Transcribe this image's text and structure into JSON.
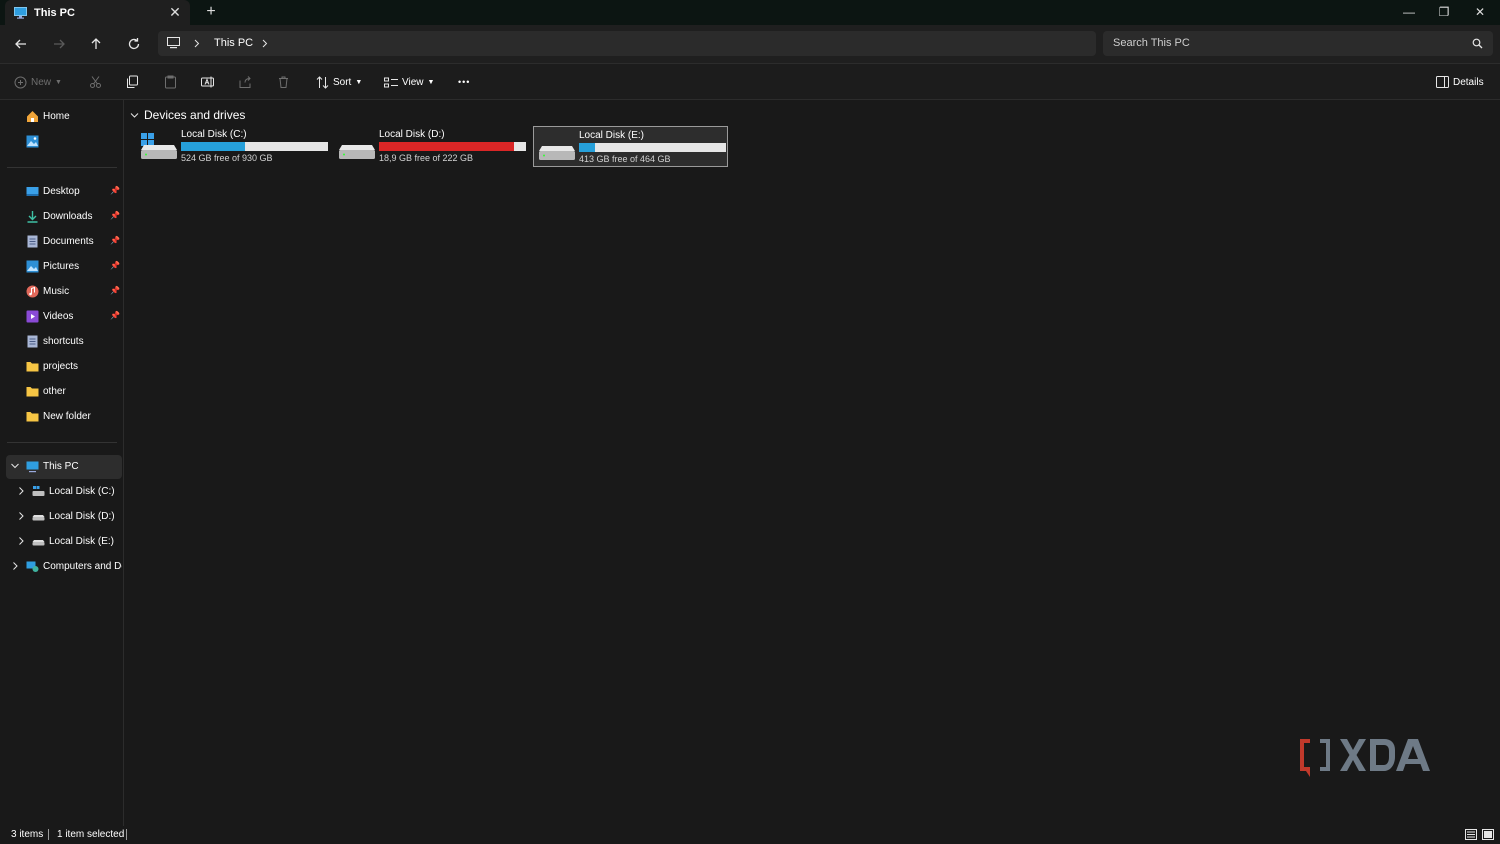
{
  "window": {
    "tab_title": "This PC",
    "tab_close": "✕",
    "new_tab": "+",
    "minimize": "—",
    "maximize": "❐",
    "close": "✕"
  },
  "address": {
    "path": "This PC",
    "search_placeholder": "Search This PC"
  },
  "commands": {
    "new": "New",
    "sort": "Sort",
    "view": "View",
    "more": "•••",
    "details": "Details"
  },
  "sidebar": {
    "home": "Home",
    "quick_access": [
      {
        "label": "Desktop",
        "pinned": true
      },
      {
        "label": "Downloads",
        "pinned": true
      },
      {
        "label": "Documents",
        "pinned": true
      },
      {
        "label": "Pictures",
        "pinned": true
      },
      {
        "label": "Music",
        "pinned": true
      },
      {
        "label": "Videos",
        "pinned": true
      },
      {
        "label": "shortcuts",
        "pinned": false
      },
      {
        "label": "projects",
        "pinned": false
      },
      {
        "label": "other",
        "pinned": false
      },
      {
        "label": "New folder",
        "pinned": false
      }
    ],
    "this_pc": "This PC",
    "drives": [
      "Local Disk (C:)",
      "Local Disk (D:)",
      "Local Disk (E:)"
    ],
    "network": "Computers and Devices",
    "pin_glyph": "📌"
  },
  "main": {
    "group_title": "Devices and drives",
    "drives": [
      {
        "name": "Local Disk (C:)",
        "free_text": "524 GB free of 930 GB",
        "used_fraction": 0.437,
        "bar_color": "#26a0da",
        "windows": true
      },
      {
        "name": "Local Disk (D:)",
        "free_text": "18,9 GB free of 222 GB",
        "used_fraction": 0.915,
        "bar_color": "#da2626",
        "windows": false
      },
      {
        "name": "Local Disk (E:)",
        "free_text": "413 GB free of 464 GB",
        "used_fraction": 0.11,
        "bar_color": "#26a0da",
        "windows": false,
        "selected": true
      }
    ]
  },
  "status": {
    "items": "3 items",
    "selected": "1 item selected"
  },
  "colors": {
    "accent": "#26a0da",
    "warning": "#da2626",
    "folder": "#f6c544"
  },
  "watermark": "XDA"
}
